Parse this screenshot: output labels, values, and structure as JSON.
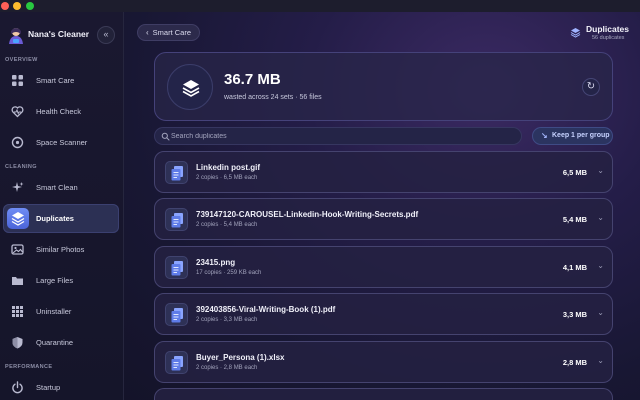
{
  "app": {
    "name": "Nana's Cleaner"
  },
  "sidebar": {
    "sections": [
      {
        "label": "OVERVIEW",
        "items": [
          {
            "label": "Smart Care",
            "icon": "grid-icon",
            "active": false
          },
          {
            "label": "Health Check",
            "icon": "heartbeat-icon",
            "active": false
          },
          {
            "label": "Space Scanner",
            "icon": "disk-icon",
            "active": false
          }
        ]
      },
      {
        "label": "CLEANING",
        "items": [
          {
            "label": "Smart Clean",
            "icon": "sparkle-icon",
            "active": false
          },
          {
            "label": "Duplicates",
            "icon": "layers-icon",
            "active": true
          },
          {
            "label": "Similar Photos",
            "icon": "photo-icon",
            "active": false
          },
          {
            "label": "Large Files",
            "icon": "folder-icon",
            "active": false
          },
          {
            "label": "Uninstaller",
            "icon": "apps-grid-icon",
            "active": false
          },
          {
            "label": "Quarantine",
            "icon": "shield-icon",
            "active": false
          }
        ]
      },
      {
        "label": "PERFORMANCE",
        "items": [
          {
            "label": "Startup",
            "icon": "power-icon",
            "active": false
          }
        ]
      }
    ]
  },
  "header": {
    "back_label": "Smart Care",
    "title": "Duplicates",
    "subtitle": "56 duplicates"
  },
  "summary": {
    "size": "36.7 MB",
    "description": "wasted across 24 sets · 56 files"
  },
  "search": {
    "placeholder": "Search duplicates",
    "value": ""
  },
  "keep_button": {
    "label": "Keep 1 per group"
  },
  "files": [
    {
      "name": "Linkedin post.gif",
      "meta": "2 copies · 6,5 MB each",
      "size": "6,5 MB"
    },
    {
      "name": "739147120-CAROUSEL-Linkedin-Hook-Writing-Secrets.pdf",
      "meta": "2 copies · 5,4 MB each",
      "size": "5,4 MB"
    },
    {
      "name": "23415.png",
      "meta": "17 copies · 259 KB each",
      "size": "4,1 MB"
    },
    {
      "name": "392403856-Viral-Writing-Book (1).pdf",
      "meta": "2 copies · 3,3 MB each",
      "size": "3,3 MB"
    },
    {
      "name": "Buyer_Persona (1).xlsx",
      "meta": "2 copies · 2,8 MB each",
      "size": "2,8 MB"
    }
  ],
  "colors": {
    "accent": "#5b78ea",
    "active_nav_bg": "#2c3054",
    "window_red": "#fe5f57",
    "window_yellow": "#febc2e",
    "window_green": "#28c840"
  }
}
